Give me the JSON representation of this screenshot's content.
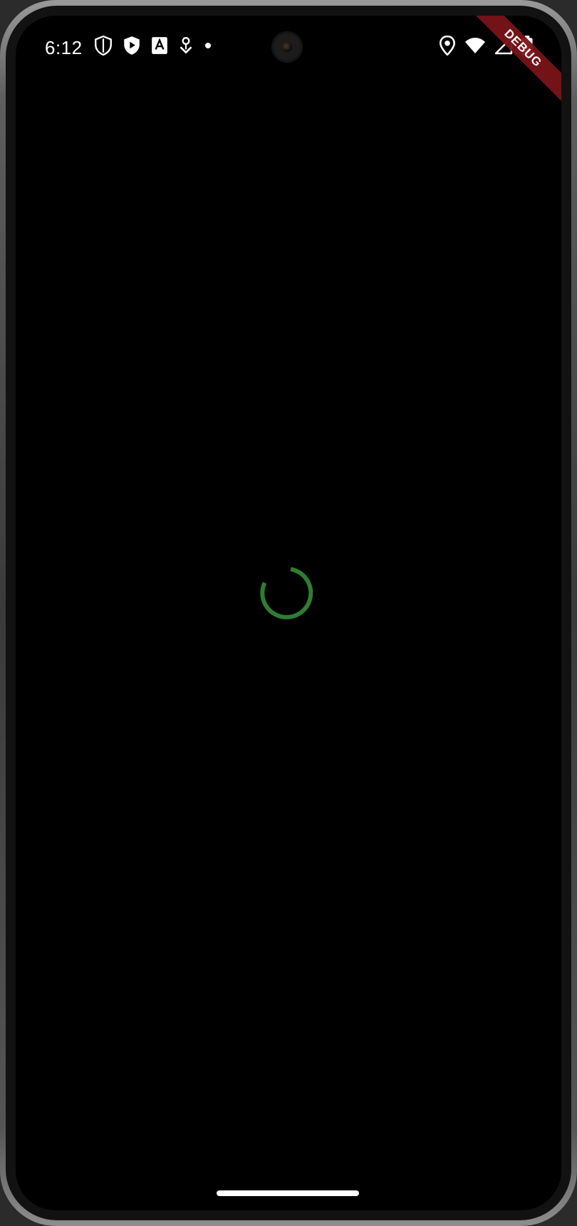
{
  "status_bar": {
    "time": "6:12",
    "left_icons": [
      "shield-outline-icon",
      "shield-play-icon",
      "font-a-icon",
      "location-pin-badge-icon",
      "notification-dot-icon"
    ],
    "right_icons": [
      "location-icon",
      "wifi-icon",
      "cellular-signal-icon",
      "battery-icon"
    ]
  },
  "debug_banner": {
    "label": "DEBUG",
    "color": "#7a1419"
  },
  "loading": {
    "state": "loading",
    "spinner_color": "#2e7d32"
  }
}
